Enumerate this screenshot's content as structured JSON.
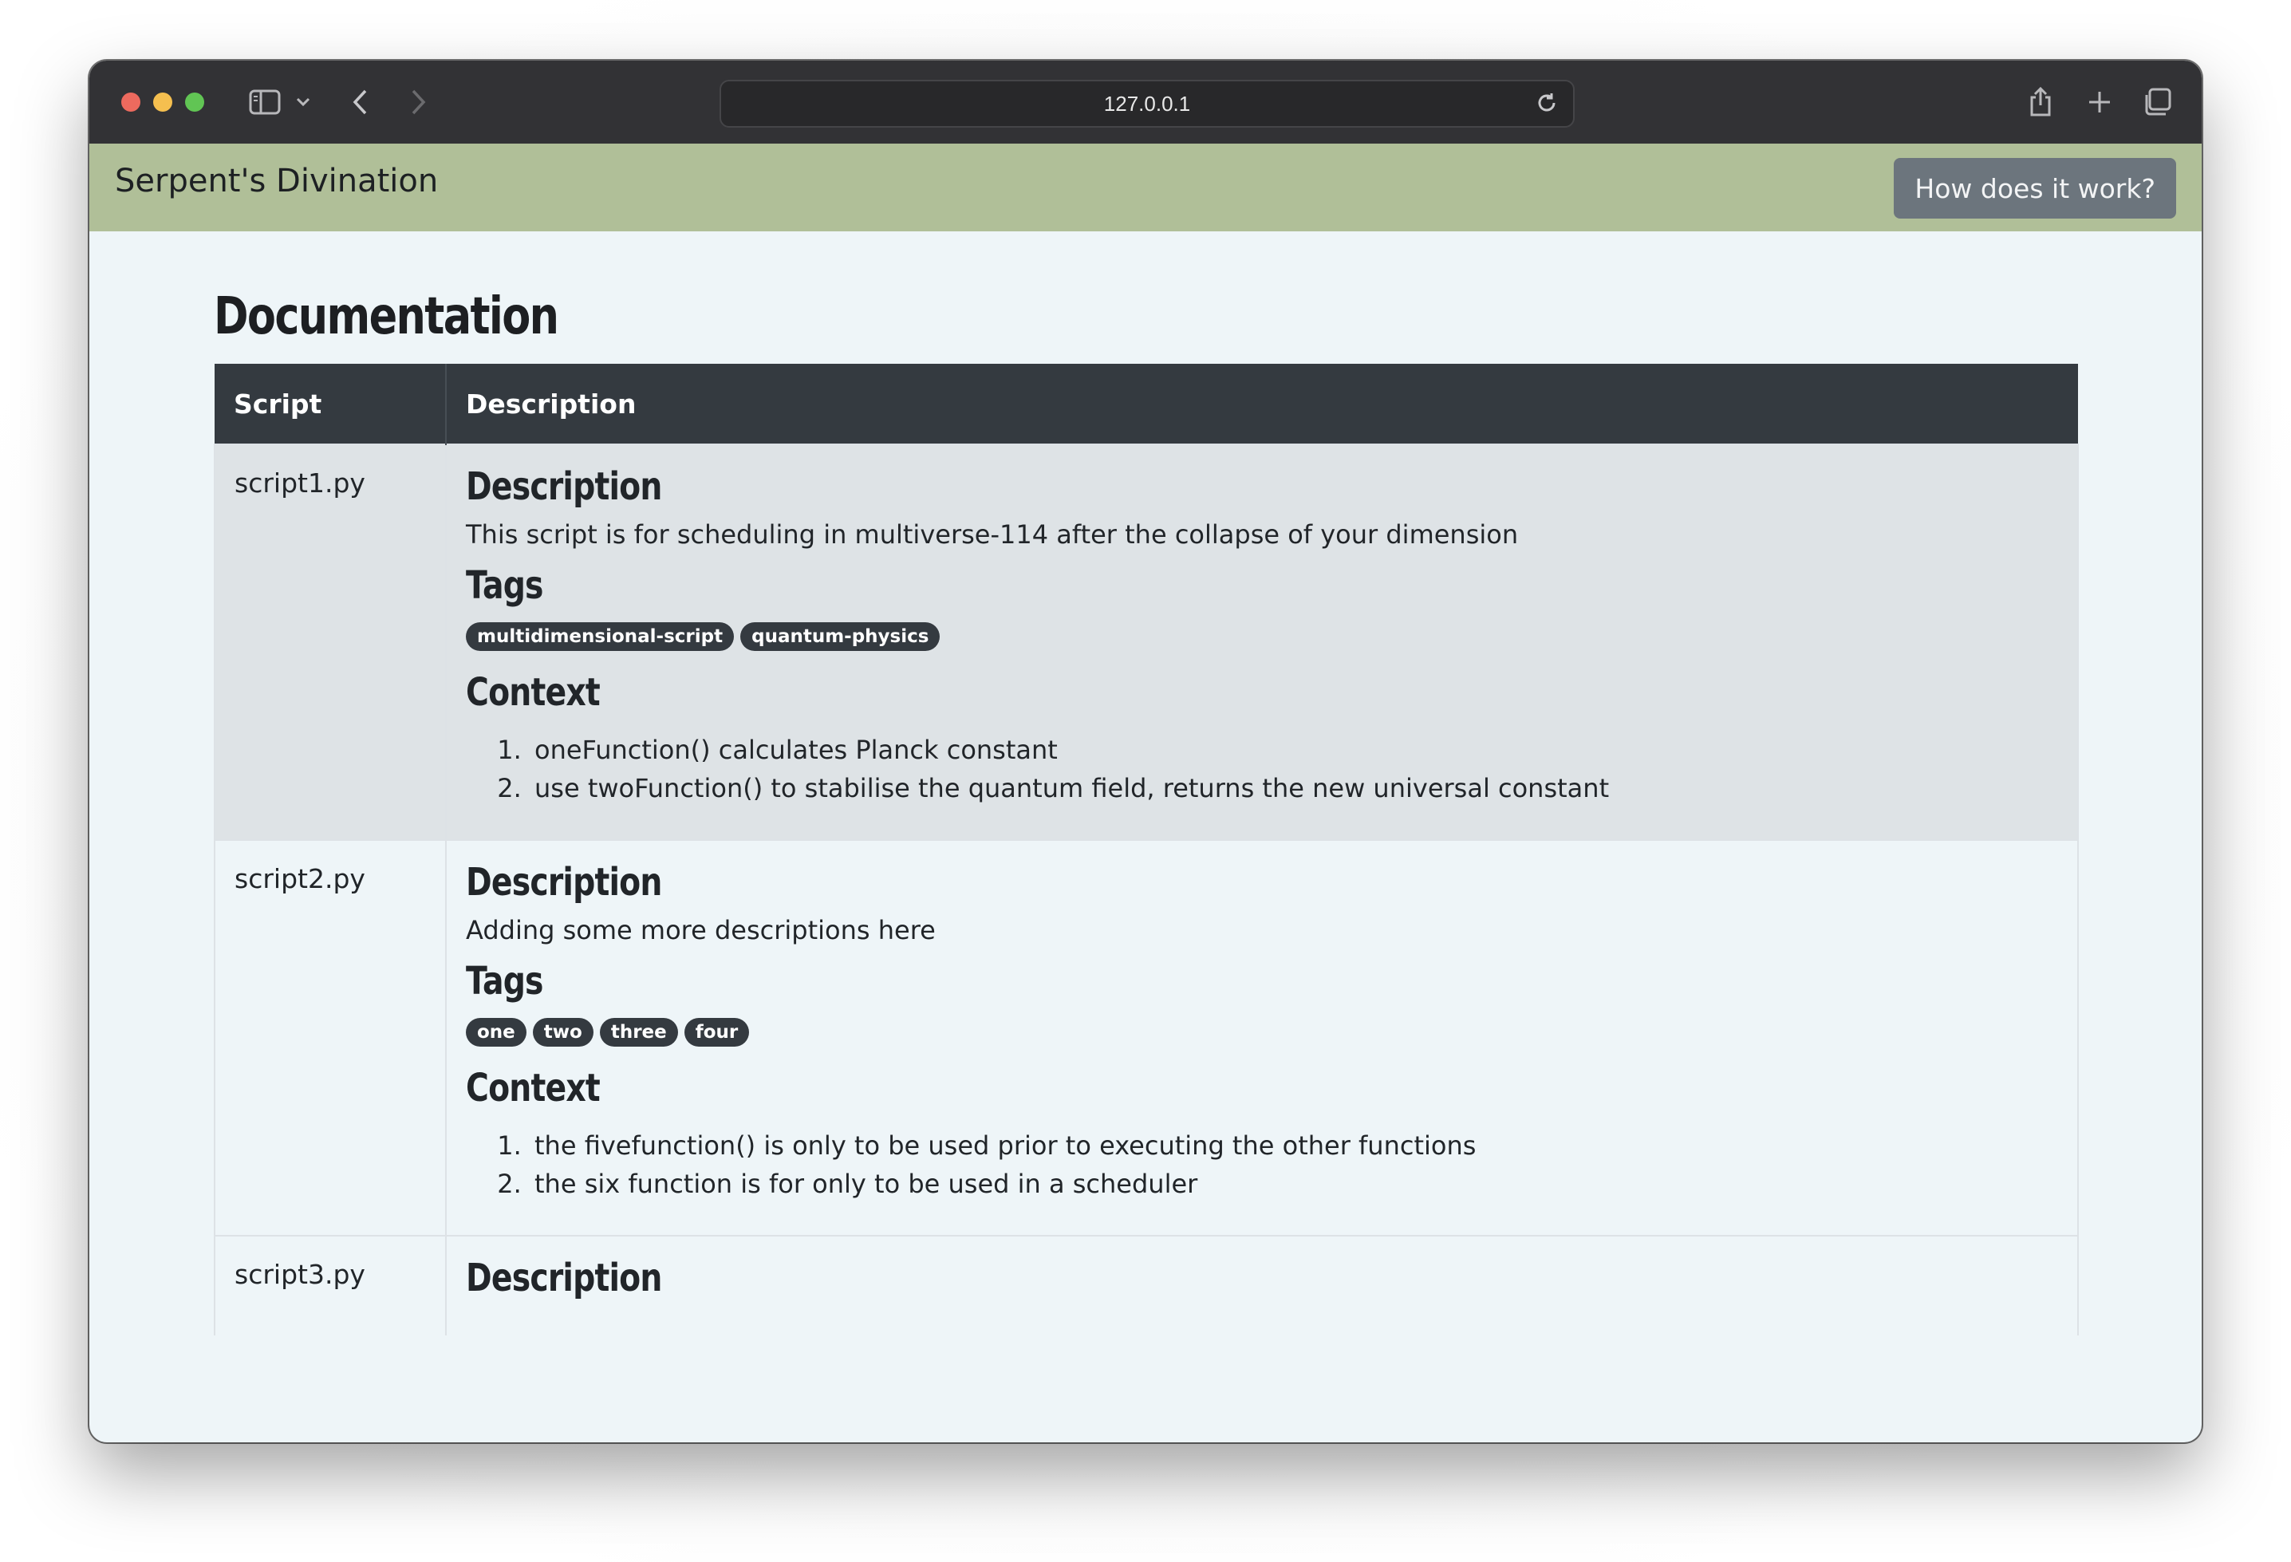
{
  "browser": {
    "url": "127.0.0.1"
  },
  "header": {
    "brand": "Serpent's Divination",
    "how_button": "How does it work?"
  },
  "page": {
    "title": "Documentation",
    "columns": [
      "Script",
      "Description"
    ]
  },
  "scripts": [
    {
      "name": "script1.py",
      "description_heading": "Description",
      "description": "This script is for scheduling in multiverse-114 after the collapse of your dimension",
      "tags_heading": "Tags",
      "tags": [
        "multidimensional-script",
        "quantum-physics"
      ],
      "context_heading": "Context",
      "context": [
        "oneFunction() calculates Planck constant",
        "use twoFunction() to stabilise the quantum field, returns the new universal constant"
      ]
    },
    {
      "name": "script2.py",
      "description_heading": "Description",
      "description": "Adding some more descriptions here",
      "tags_heading": "Tags",
      "tags": [
        "one",
        "two",
        "three",
        "four"
      ],
      "context_heading": "Context",
      "context": [
        "the fivefunction() is only to be used prior to executing the other functions",
        "the six function is for only to be used in a scheduler"
      ]
    },
    {
      "name": "script3.py",
      "description_heading": "Description"
    }
  ]
}
